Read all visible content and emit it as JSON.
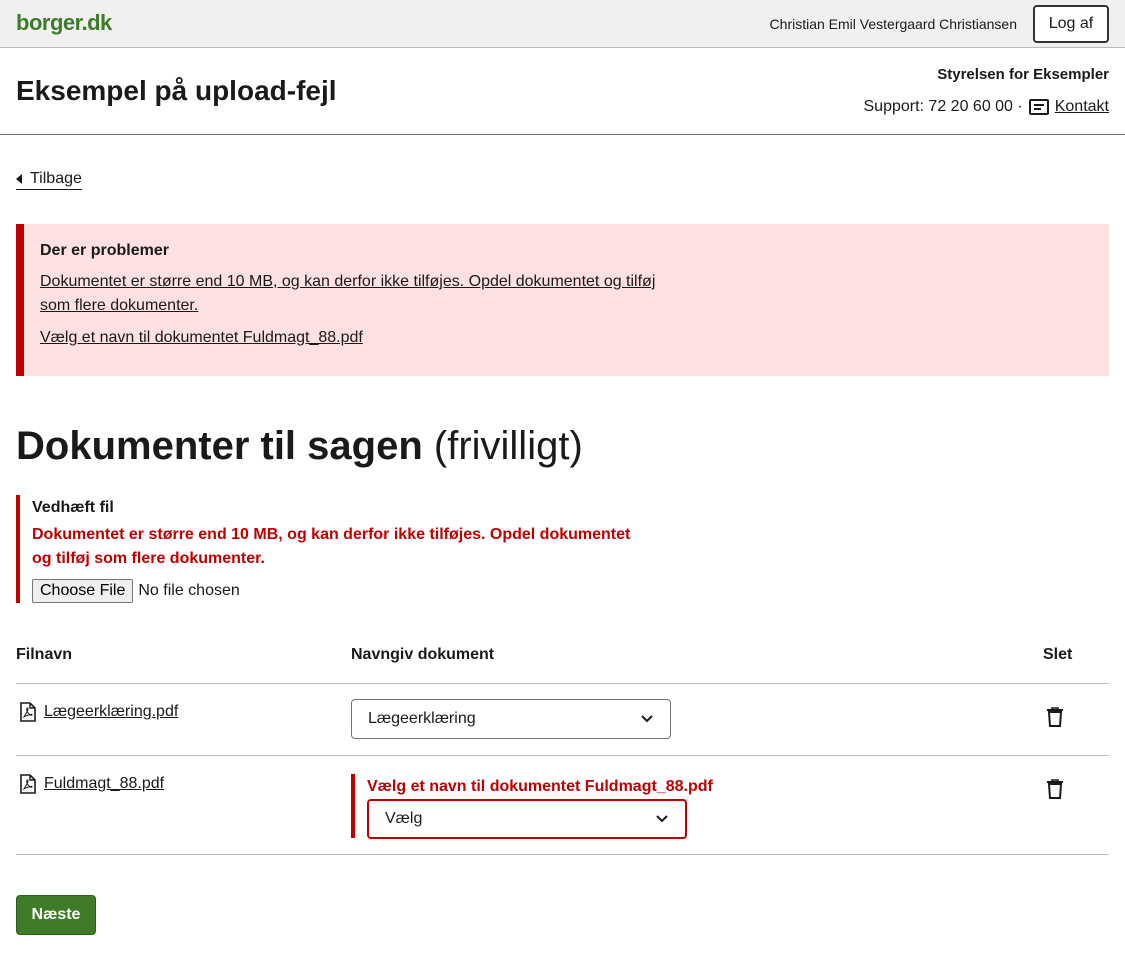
{
  "topbar": {
    "logo": "borger.dk",
    "username": "Christian Emil Vestergaard Christiansen",
    "logout_label": "Log af"
  },
  "header": {
    "title": "Eksempel på upload-fejl",
    "authority": "Styrelsen for Eksempler",
    "support": "Support: 72 20 60 00 ·",
    "contact_label": "Kontakt"
  },
  "back_link": "Tilbage",
  "error_summary": {
    "title": "Der er problemer",
    "errors": [
      "Dokumentet er større end 10 MB, og kan derfor ikke tilføjes. Opdel dokumentet og tilføj som flere dokumenter.",
      "Vælg et navn til dokumentet Fuldmagt_88.pdf"
    ]
  },
  "section": {
    "title": "Dokumenter til sagen",
    "optional": "(frivilligt)"
  },
  "upload": {
    "label": "Vedhæft fil",
    "error": "Dokumentet er større end 10 MB, og kan derfor ikke tilføjes. Opdel dokumentet og tilføj som flere dokumenter.",
    "choose_label": "Choose File",
    "no_file": "No file chosen"
  },
  "table": {
    "headers": [
      "Filnavn",
      "Navngiv dokument",
      "Slet"
    ],
    "rows": [
      {
        "filename": "Lægeerklæring.pdf",
        "doc_name": "Lægeerklæring",
        "error": ""
      },
      {
        "filename": "Fuldmagt_88.pdf",
        "doc_name": "Vælg",
        "error": "Vælg et navn til dokumentet Fuldmagt_88.pdf"
      }
    ]
  },
  "next_label": "Næste",
  "colors": {
    "brand_green": "#3f7c2a",
    "error_red": "#c00000",
    "error_bg": "#fde0e0"
  }
}
